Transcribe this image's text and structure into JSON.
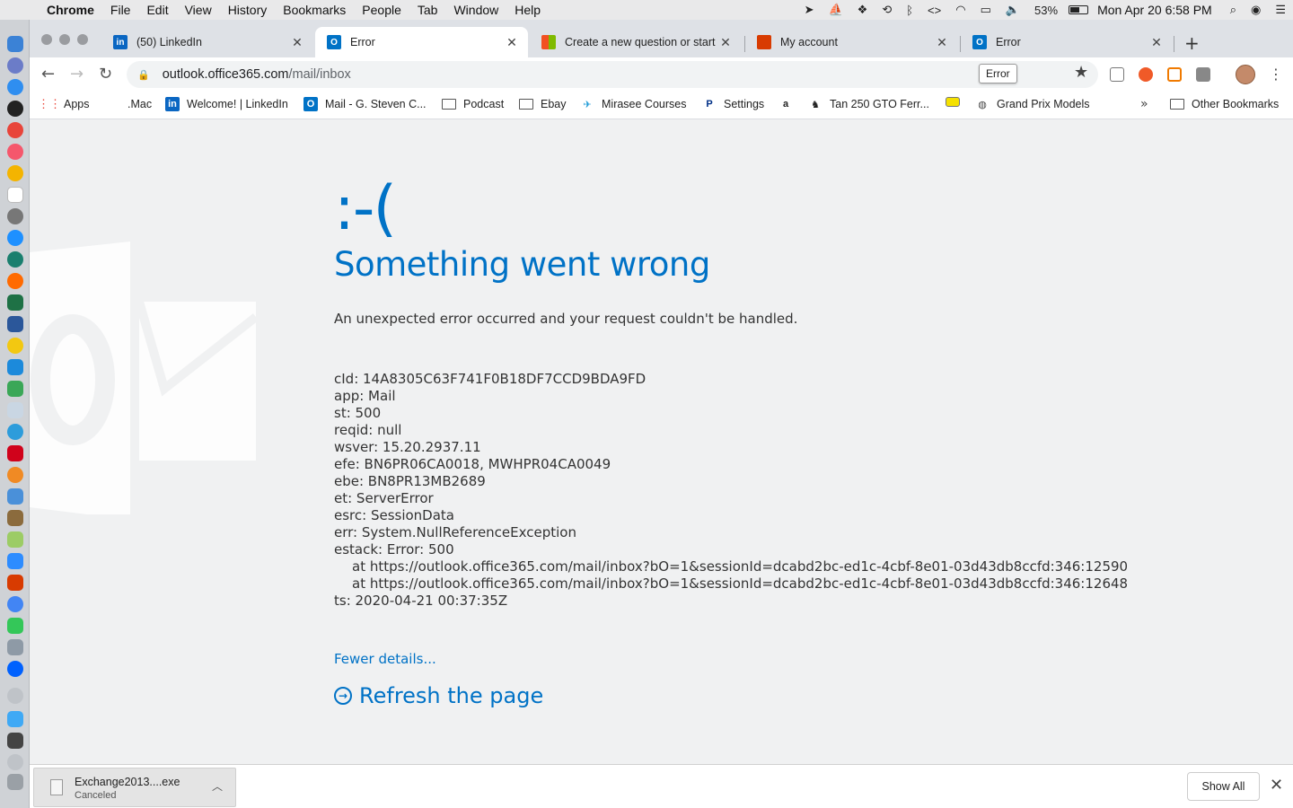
{
  "menubar": {
    "items": [
      "Chrome",
      "File",
      "Edit",
      "View",
      "History",
      "Bookmarks",
      "People",
      "Tab",
      "Window",
      "Help"
    ],
    "battery_percent": "53%",
    "battery_level": 0.53,
    "clock": "Mon Apr 20  6:58 PM"
  },
  "tabs": [
    {
      "title": "(50) LinkedIn",
      "icon": "linkedin-icon",
      "color": "#0a66c2"
    },
    {
      "title": "Error",
      "icon": "outlook-icon",
      "color": "#0072c6"
    },
    {
      "title": "Create a new question or start",
      "icon": "microsoft-icon",
      "color": "#f25022"
    },
    {
      "title": "My account",
      "icon": "office-icon",
      "color": "#d83b01"
    },
    {
      "title": "Error",
      "icon": "outlook-icon",
      "color": "#0072c6"
    }
  ],
  "omnibox": {
    "host": "outlook.office365.com",
    "path": "/mail/inbox",
    "tooltip": "Error"
  },
  "bookmarks": [
    {
      "label": "Apps",
      "icon": "apps-grid-icon"
    },
    {
      "label": ".Mac",
      "icon": "apple-icon"
    },
    {
      "label": "Welcome! | LinkedIn",
      "icon": "linkedin-icon"
    },
    {
      "label": "Mail - G. Steven C...",
      "icon": "outlook-icon"
    },
    {
      "label": "Podcast",
      "icon": "folder-icon"
    },
    {
      "label": "Ebay",
      "icon": "folder-icon"
    },
    {
      "label": "Mirasee Courses",
      "icon": "mirasee-icon"
    },
    {
      "label": "Settings",
      "icon": "paypal-icon"
    },
    {
      "label": "",
      "icon": "amazon-icon"
    },
    {
      "label": "Tan 250 GTO Ferr...",
      "icon": "ferrari-icon"
    },
    {
      "label": "",
      "icon": "tag-icon"
    },
    {
      "label": "Grand Prix Models",
      "icon": "globe-icon"
    }
  ],
  "other_bookmarks": "Other Bookmarks",
  "error": {
    "frown": ":-(",
    "headline": "Something went wrong",
    "description": "An unexpected error occurred and your request couldn't be handled.",
    "details": [
      "cId: 14A8305C63F741F0B18DF7CCD9BDA9FD",
      "app: Mail",
      "st: 500",
      "reqid: null",
      "wsver: 15.20.2937.11",
      "efe: BN6PR06CA0018, MWHPR04CA0049",
      "ebe: BN8PR13MB2689",
      "et: ServerError",
      "esrc: SessionData",
      "err: System.NullReferenceException",
      "estack: Error: 500"
    ],
    "stack_lines": [
      "at https://outlook.office365.com/mail/inbox?bO=1&sessionId=dcabd2bc-ed1c-4cbf-8e01-03d43db8ccfd:346:12590",
      "at https://outlook.office365.com/mail/inbox?bO=1&sessionId=dcabd2bc-ed1c-4cbf-8e01-03d43db8ccfd:346:12648"
    ],
    "timestamp": "ts: 2020-04-21 00:37:35Z",
    "fewer_details": "Fewer details...",
    "refresh": "Refresh the page"
  },
  "download": {
    "filename": "Exchange2013....exe",
    "status": "Canceled",
    "show_all": "Show All"
  },
  "colors": {
    "accent": "#0072c6",
    "page_bg": "#f0f1f2"
  }
}
